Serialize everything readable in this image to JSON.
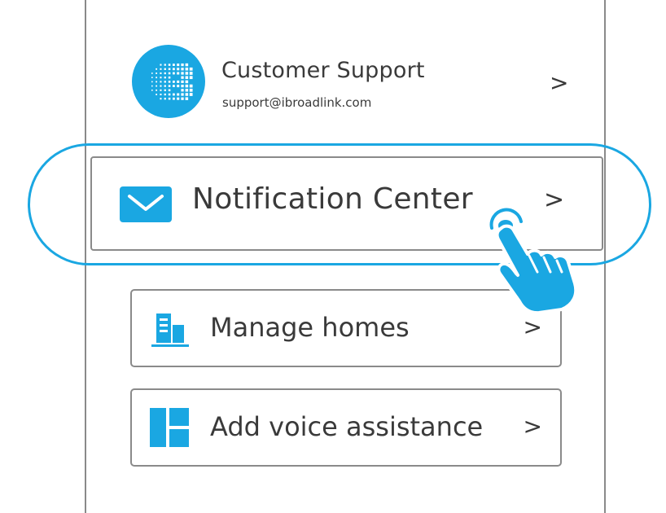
{
  "colors": {
    "accent": "#1aa7e2",
    "text": "#3a3a3a",
    "border": "#8a8a8a"
  },
  "support": {
    "avatar_icon": "broadlink-logo-icon",
    "title": "Customer Support",
    "email": "support@ibroadlink.com",
    "chevron": ">"
  },
  "menu": {
    "notification": {
      "icon": "envelope-icon",
      "label": "Notification Center",
      "chevron": ">"
    },
    "homes": {
      "icon": "building-icon",
      "label": "Manage homes",
      "chevron": ">"
    },
    "voice": {
      "icon": "tiles-icon",
      "label": "Add voice assistance",
      "chevron": ">"
    }
  },
  "overlay": {
    "hand_icon": "tap-hand-icon"
  }
}
